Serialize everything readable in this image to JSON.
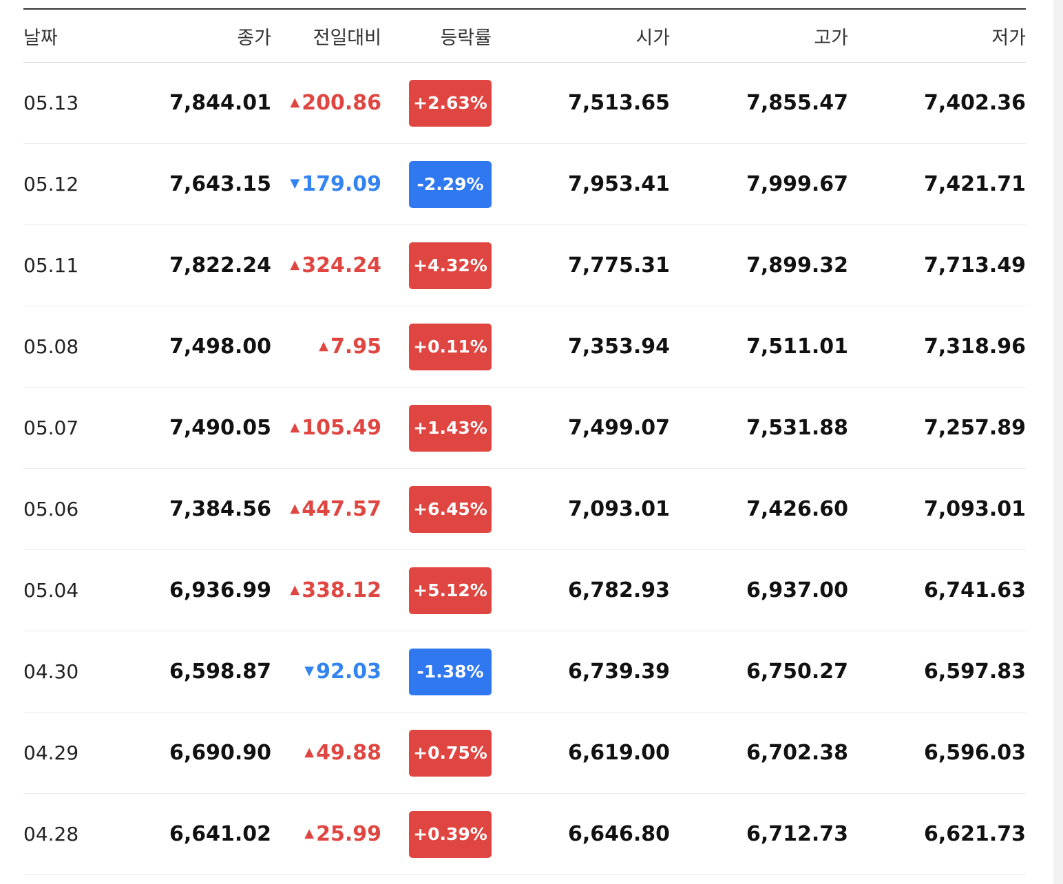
{
  "colors": {
    "up": "#e04641",
    "down": "#3384f0",
    "up_badge": "#e04641",
    "down_badge": "#2f78f0"
  },
  "header": {
    "date": "날짜",
    "close": "종가",
    "change": "전일대비",
    "rate": "등락률",
    "open": "시가",
    "high": "고가",
    "low": "저가"
  },
  "rows": [
    {
      "date": "05.13",
      "close": "7,844.01",
      "dir": "up",
      "change": "200.86",
      "rate": "+2.63%",
      "open": "7,513.65",
      "high": "7,855.47",
      "low": "7,402.36"
    },
    {
      "date": "05.12",
      "close": "7,643.15",
      "dir": "down",
      "change": "179.09",
      "rate": "-2.29%",
      "open": "7,953.41",
      "high": "7,999.67",
      "low": "7,421.71"
    },
    {
      "date": "05.11",
      "close": "7,822.24",
      "dir": "up",
      "change": "324.24",
      "rate": "+4.32%",
      "open": "7,775.31",
      "high": "7,899.32",
      "low": "7,713.49"
    },
    {
      "date": "05.08",
      "close": "7,498.00",
      "dir": "up",
      "change": "7.95",
      "rate": "+0.11%",
      "open": "7,353.94",
      "high": "7,511.01",
      "low": "7,318.96"
    },
    {
      "date": "05.07",
      "close": "7,490.05",
      "dir": "up",
      "change": "105.49",
      "rate": "+1.43%",
      "open": "7,499.07",
      "high": "7,531.88",
      "low": "7,257.89"
    },
    {
      "date": "05.06",
      "close": "7,384.56",
      "dir": "up",
      "change": "447.57",
      "rate": "+6.45%",
      "open": "7,093.01",
      "high": "7,426.60",
      "low": "7,093.01"
    },
    {
      "date": "05.04",
      "close": "6,936.99",
      "dir": "up",
      "change": "338.12",
      "rate": "+5.12%",
      "open": "6,782.93",
      "high": "6,937.00",
      "low": "6,741.63"
    },
    {
      "date": "04.30",
      "close": "6,598.87",
      "dir": "down",
      "change": "92.03",
      "rate": "-1.38%",
      "open": "6,739.39",
      "high": "6,750.27",
      "low": "6,597.83"
    },
    {
      "date": "04.29",
      "close": "6,690.90",
      "dir": "up",
      "change": "49.88",
      "rate": "+0.75%",
      "open": "6,619.00",
      "high": "6,702.38",
      "low": "6,596.03"
    },
    {
      "date": "04.28",
      "close": "6,641.02",
      "dir": "up",
      "change": "25.99",
      "rate": "+0.39%",
      "open": "6,646.80",
      "high": "6,712.73",
      "low": "6,621.73"
    }
  ]
}
